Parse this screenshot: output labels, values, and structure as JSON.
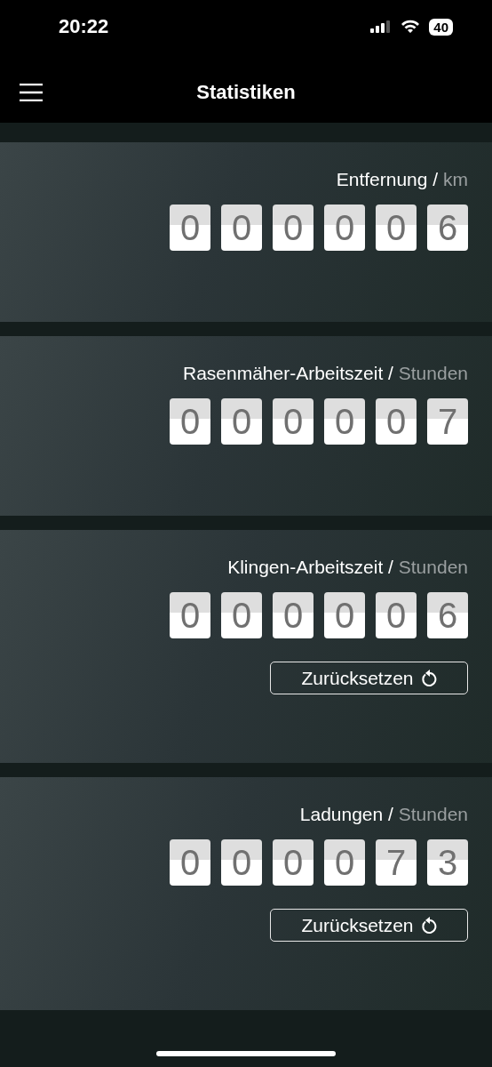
{
  "status_bar": {
    "time": "20:22",
    "battery": "40"
  },
  "header": {
    "title": "Statistiken"
  },
  "cards": [
    {
      "title": "Entfernung /",
      "unit": "km",
      "digits": [
        "0",
        "0",
        "0",
        "0",
        "0",
        "6"
      ]
    },
    {
      "title": "Rasenmäher-Arbeitszeit /",
      "unit": "Stunden",
      "digits": [
        "0",
        "0",
        "0",
        "0",
        "0",
        "7"
      ]
    },
    {
      "title": "Klingen-Arbeitszeit /",
      "unit": "Stunden",
      "digits": [
        "0",
        "0",
        "0",
        "0",
        "0",
        "6"
      ],
      "reset": "Zurücksetzen"
    },
    {
      "title": "Ladungen /",
      "unit": "Stunden",
      "digits": [
        "0",
        "0",
        "0",
        "0",
        "7",
        "3"
      ],
      "reset": "Zurücksetzen"
    }
  ]
}
